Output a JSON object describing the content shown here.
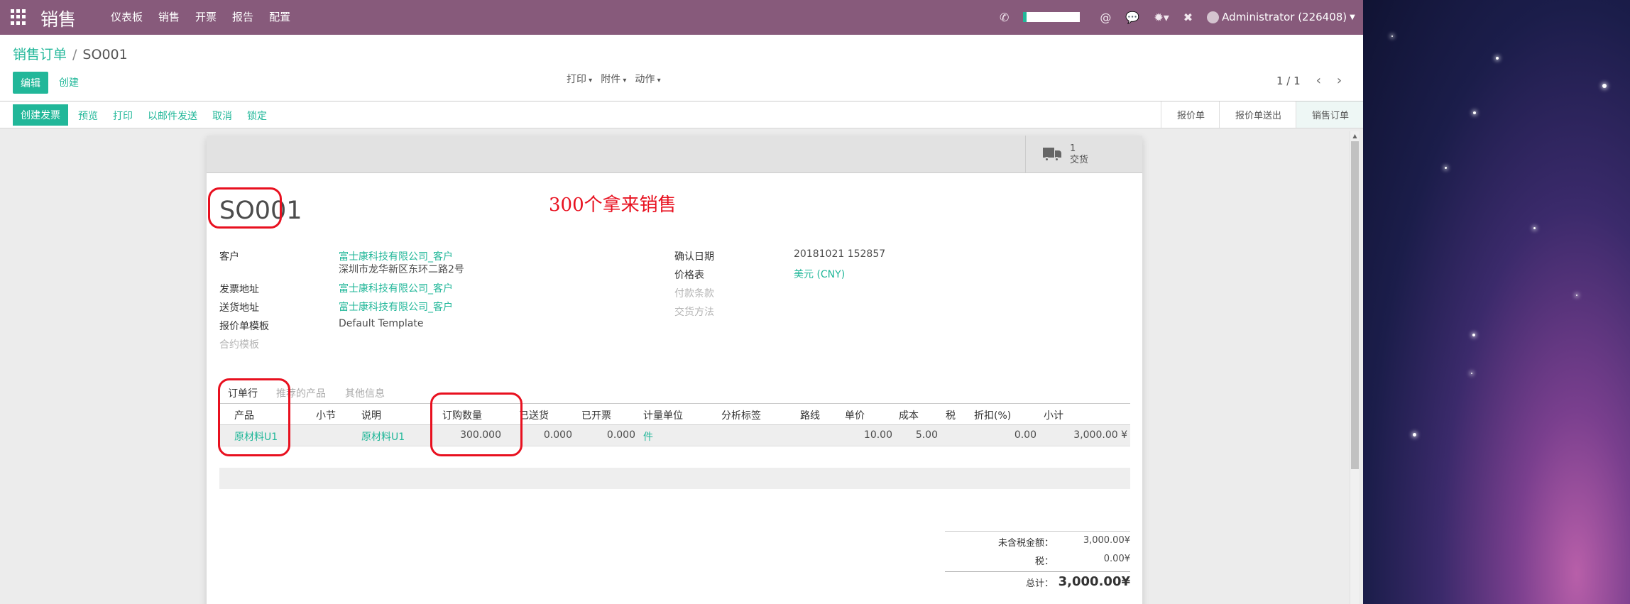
{
  "app": {
    "title": "销售",
    "menu": [
      "仪表板",
      "销售",
      "开票",
      "报告",
      "配置"
    ],
    "user": "Administrator (226408)"
  },
  "control": {
    "breadcrumb_parent": "销售订单",
    "breadcrumb_sep": "/",
    "breadcrumb_current": "SO001",
    "edit_label": "编辑",
    "create_label": "创建",
    "sidebar_menus": [
      "打印",
      "附件",
      "动作"
    ],
    "pager": "1 / 1"
  },
  "status": {
    "primary_button": "创建发票",
    "actions": [
      "预览",
      "打印",
      "以邮件发送",
      "取消",
      "锁定"
    ],
    "stages": [
      "报价单",
      "报价单送出",
      "销售订单"
    ],
    "active_stage": "销售订单"
  },
  "smart_button": {
    "count": "1",
    "label": "交货"
  },
  "form": {
    "name": "SO001",
    "annotation": "300个拿来销售",
    "left_fields": {
      "customer_label": "客户",
      "customer_name": "富士康科技有限公司_客户",
      "customer_address": "深圳市龙华新区东环二路2号",
      "invoice_address_label": "发票地址",
      "invoice_address": "富士康科技有限公司_客户",
      "delivery_address_label": "送货地址",
      "delivery_address": "富士康科技有限公司_客户",
      "template_label": "报价单模板",
      "template": "Default Template",
      "contract_template_label": "合约模板"
    },
    "right_fields": {
      "confirm_date_label": "确认日期",
      "confirm_date": "20181021 152857",
      "pricelist_label": "价格表",
      "pricelist": "美元 (CNY)",
      "payment_terms_label": "付款条款",
      "delivery_method_label": "交货方法"
    }
  },
  "notebook": {
    "tabs": [
      "订单行",
      "推荐的产品",
      "其他信息"
    ],
    "columns": [
      "产品",
      "小节",
      "说明",
      "订购数量",
      "已送货",
      "已开票",
      "计量单位",
      "分析标签",
      "路线",
      "单价",
      "成本",
      "税",
      "折扣(%)",
      "小计"
    ],
    "rows": [
      {
        "product": "原材料U1",
        "description": "原材料U1",
        "ordered_qty": "300.000",
        "delivered": "0.000",
        "invoiced": "0.000",
        "uom": "件",
        "price_unit": "10.00",
        "cost": "5.00",
        "discount": "0.00",
        "subtotal": "3,000.00 ¥"
      }
    ]
  },
  "totals": {
    "untaxed_label": "未含税金额：",
    "untaxed": "3,000.00¥",
    "tax_label": "税：",
    "tax": "0.00¥",
    "total_label": "总计：",
    "total": "3,000.00¥"
  },
  "colors": {
    "nav": "#875a7b",
    "accent": "#21b799",
    "annotation": "#e8101f"
  }
}
